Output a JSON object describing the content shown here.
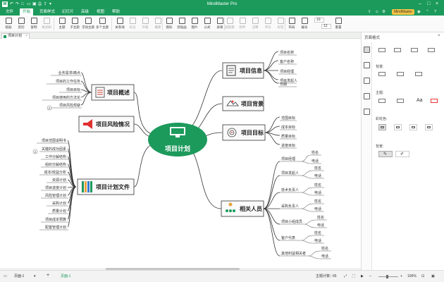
{
  "titlebar": {
    "app_title": "MindMaster Pro",
    "brand": "MindMaster"
  },
  "menu": [
    "文件",
    "开始",
    "页面样式",
    "幻灯片",
    "高级",
    "视图",
    "帮助"
  ],
  "ribbon": {
    "buttons": [
      "粘贴",
      "剪切",
      "复制",
      "格式刷",
      "主题",
      "子主题",
      "浮动主题",
      "多个主题",
      "关系线",
      "标注",
      "外框",
      "概要",
      "图标",
      "剪贴画",
      "图片",
      "公式",
      "表格",
      "超链接",
      "附件",
      "注释",
      "评论",
      "标签",
      "布局",
      "编号",
      "重置"
    ],
    "font_size": "10",
    "font_size2": "12"
  },
  "doc_tab": "项目计划",
  "map": {
    "root": "项目计划",
    "topics": {
      "info": "项目信息",
      "background": "项目背景",
      "goal": "项目目标",
      "people": "相关人员",
      "overview": "项目概述",
      "risk": "项目风险情况",
      "docs": "项目计划文件"
    },
    "info_children": [
      "项目名称",
      "客户名称",
      "项目经理",
      "项目发起人",
      "日期"
    ],
    "goal_children": [
      "范围目标",
      "成本目标",
      "质量目标",
      "进度目标"
    ],
    "people_children": [
      {
        "role": "项目经理",
        "items": [
          "姓名",
          "电话"
        ]
      },
      {
        "role": "项目发起人",
        "items": [
          "姓名",
          "电话"
        ]
      },
      {
        "role": "技术负责人",
        "items": [
          "姓名",
          "电话"
        ]
      },
      {
        "role": "采购负责人",
        "items": [
          "姓名",
          "电话"
        ]
      },
      {
        "role": "项目小组成员",
        "items": [
          "姓名",
          "电话"
        ]
      },
      {
        "role": "客户代表",
        "items": [
          "姓名",
          "电话"
        ]
      },
      {
        "role": "其他利益相关者",
        "items": [
          "姓名",
          "电话"
        ]
      }
    ],
    "overview_children": [
      "业务需求/痛点",
      "项目的工作任务",
      "项目目标",
      "项目使用的方法论",
      "项目风险规避"
    ],
    "overview_badge": "2",
    "docs_children": [
      "项目范围说明书",
      "关键的成功因素",
      "工作分解结构",
      "组织分解结构",
      "成本/效益分析",
      "资源计划",
      "项目进度计划",
      "风险管理计划",
      "采购计划",
      "质量计划",
      "项目成本预算",
      "配置管理计划"
    ],
    "docs_badge": "2"
  },
  "right_panel": {
    "title": "页面格式",
    "sections": [
      "背景:",
      "主题:",
      "彩虹色:",
      "背景:"
    ]
  },
  "status": {
    "page_label": "页面-1",
    "add": "+",
    "page_tab": "页面-1",
    "topic_count_label": "主题计数：",
    "topic_count": "65",
    "zoom": "100%"
  },
  "colors": {
    "accent": "#1c9a5c",
    "node_fill": "#fafafa",
    "line": "#333333"
  }
}
